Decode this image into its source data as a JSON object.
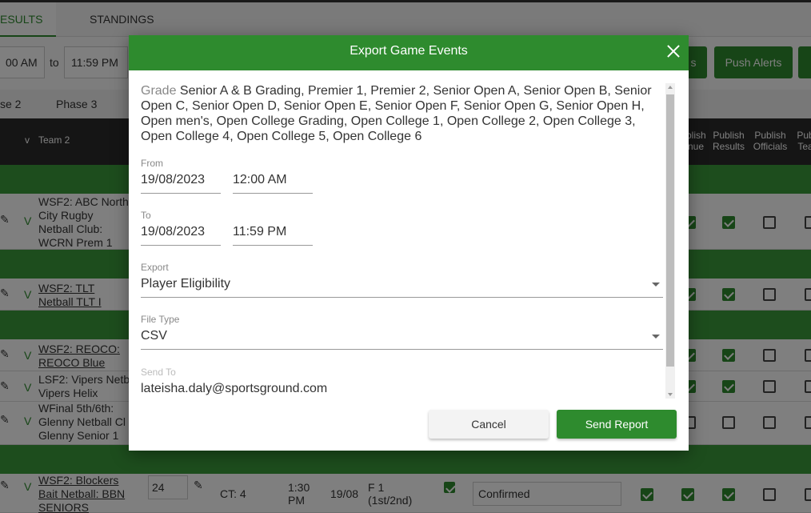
{
  "tabs": {
    "results": "ESULTS",
    "standings": "STANDINGS"
  },
  "filters": {
    "from_time": "00 AM",
    "to_label": "to",
    "to_time": "11:59 PM",
    "btn_partial": "s",
    "push_alerts": "Push Alerts"
  },
  "phases": {
    "p2": "se 2",
    "p3": "Phase 3"
  },
  "table_header": {
    "v": "v",
    "team2": "Team 2",
    "publish_venue": "blish\nnue",
    "publish_results": "Publish\nResults",
    "publish_officials": "Publish\nOfficials",
    "publish_teams": "Pub\nTea"
  },
  "rows": [
    {
      "team2": "WSF2: ABC North City Rugby Netball Club: WCRN Prem 1"
    },
    {
      "team2": "WSF2: TLT Netball TLT I"
    },
    {
      "team2": "WSF2: REOCO: REOCO Blue"
    },
    {
      "team2": "LSF2: Vipers Netb Vipers Helix"
    },
    {
      "team2": "WFinal 5th/6th: Glenny  Netball Cl Glenny  Senior 1"
    },
    {
      "team2": "WSF2: Blockers Bait Netball: BBN SENIORS",
      "score": "24",
      "ct": "CT: 4",
      "time": "1:30 PM",
      "date": "19/08",
      "round": "F 1 (1st/2nd)",
      "status": "Confirmed"
    }
  ],
  "modal": {
    "title": "Export Game Events",
    "grade_label": "Grade",
    "grade_value": "Senior A & B Grading, Premier 1, Premier 2, Senior Open A, Senior Open B, Senior Open C, Senior Open D, Senior Open E, Senior Open F, Senior Open G, Senior Open H, Open men's, Open College Grading, Open College 1, Open College 2, Open College 3, Open College 4, Open College 5, Open College 6",
    "from_label": "From",
    "from_date": "19/08/2023",
    "from_time": "12:00 AM",
    "to_label": "To",
    "to_date": "19/08/2023",
    "to_time": "11:59 PM",
    "export_label": "Export",
    "export_value": "Player Eligibility",
    "filetype_label": "File Type",
    "filetype_value": "CSV",
    "sendto_label": "Send To",
    "sendto_value": "lateisha.daly@sportsground.com",
    "cancel": "Cancel",
    "send": "Send Report"
  },
  "colors": {
    "accent": "#2e8b2e",
    "header_dark": "#2b2b2b"
  }
}
